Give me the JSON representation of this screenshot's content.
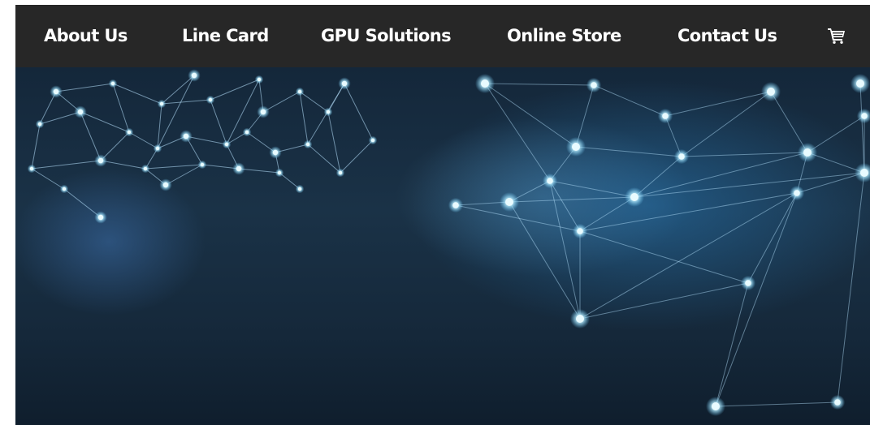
{
  "nav": {
    "items": [
      {
        "label": "About Us"
      },
      {
        "label": "Line Card"
      },
      {
        "label": "GPU Solutions"
      },
      {
        "label": "Online Store"
      },
      {
        "label": "Contact Us"
      }
    ],
    "cart_icon": "shopping-cart-icon"
  },
  "hero": {
    "image": "network-nodes-background"
  },
  "colors": {
    "navbar_bg": "#272727",
    "nav_text": "#ffffff",
    "hero_dark": "#14273a",
    "node_glow": "#9fe6ff"
  }
}
